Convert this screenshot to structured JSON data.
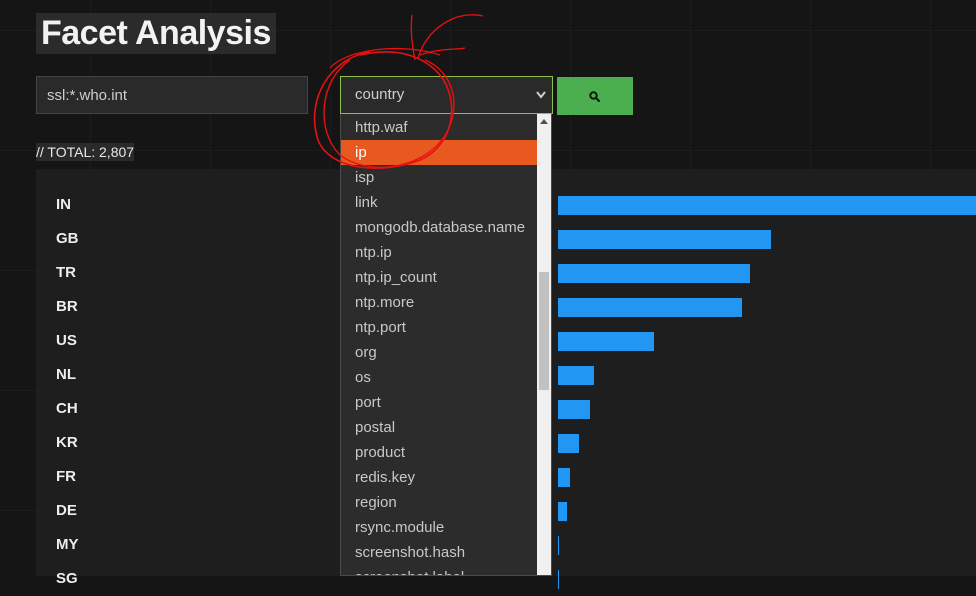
{
  "page": {
    "title": "Facet Analysis"
  },
  "search": {
    "query_value": "ssl:*.who.int",
    "facet_selected": "country",
    "search_icon": "search-icon"
  },
  "summary": {
    "total_text": "// TOTAL: 2,807"
  },
  "facet_dropdown": {
    "items": [
      "http.waf",
      "ip",
      "isp",
      "link",
      "mongodb.database.name",
      "ntp.ip",
      "ntp.ip_count",
      "ntp.more",
      "ntp.port",
      "org",
      "os",
      "port",
      "postal",
      "product",
      "redis.key",
      "region",
      "rsync.module",
      "screenshot.hash",
      "screenshot.label"
    ],
    "highlighted": "ip",
    "highlight_color": "#e8591f"
  },
  "chart_data": {
    "type": "bar",
    "orientation": "horizontal",
    "categories": [
      "IN",
      "GB",
      "TR",
      "BR",
      "US",
      "NL",
      "CH",
      "KR",
      "FR",
      "DE",
      "MY",
      "SG"
    ],
    "values": [
      1.0,
      0.51,
      0.46,
      0.44,
      0.23,
      0.085,
      0.076,
      0.05,
      0.028,
      0.021,
      0.002,
      0.002
    ],
    "value_note": "relative bar length, largest = 1",
    "bar_color": "#2196f3"
  },
  "colors": {
    "accent_green": "#4bae4f",
    "select_border": "#8cc04a",
    "annotation_red": "#e81010"
  }
}
